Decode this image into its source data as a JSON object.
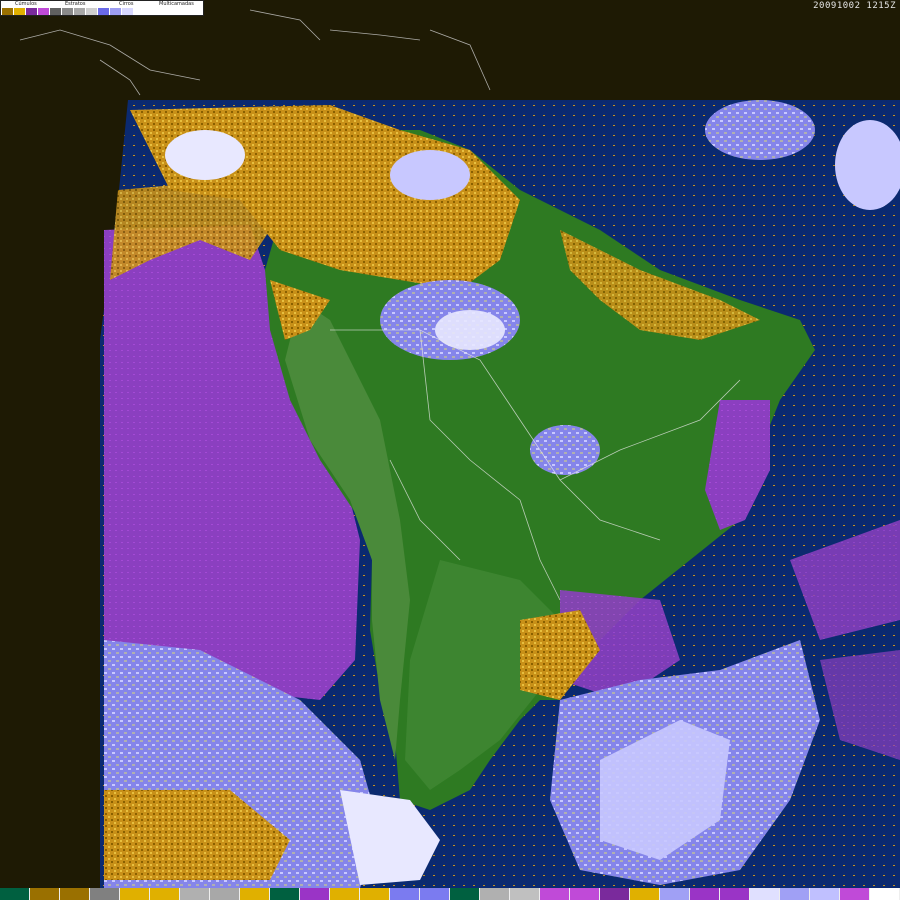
{
  "timestamp": "20091002 1215Z",
  "legend": {
    "labels": [
      "Cúmulos",
      "Estratos",
      "Cirros",
      "Multicamadas"
    ],
    "top_colors": [
      "#9a7000",
      "#e0b000",
      "#7a2a9c",
      "#c04ad8",
      "#606060",
      "#8a8a8a",
      "#a8a8a8",
      "#cfcfcf",
      "#6a6ae8",
      "#9d9df2",
      "#d8d8ff",
      "#ffffff"
    ]
  },
  "bottom_colors": [
    "#006040",
    "#9a7000",
    "#9a7000",
    "#808080",
    "#e0b000",
    "#e0b000",
    "#b0b0b0",
    "#a8a8a8",
    "#e0b000",
    "#006040",
    "#9a34c6",
    "#e0b000",
    "#e0b000",
    "#7b7bf0",
    "#7b7bf0",
    "#006040",
    "#b0b0b0",
    "#c0c0c0",
    "#c04ad8",
    "#c04ad8",
    "#7a2a9c",
    "#e0b000",
    "#a0a0f5",
    "#9a34c6",
    "#9a34c6",
    "#e0e0ff",
    "#a0a0f5",
    "#c0c0ff",
    "#c04ad8",
    "#ffffff"
  ],
  "colors": {
    "background": "#1e1a04",
    "ocean": "#0a2a6e",
    "land": "#2e7a22",
    "stratus": "#8b3fc0",
    "cumulus": "#c89018",
    "cirrus": "#8a8aee",
    "multilayer": "#e8e8ff"
  }
}
